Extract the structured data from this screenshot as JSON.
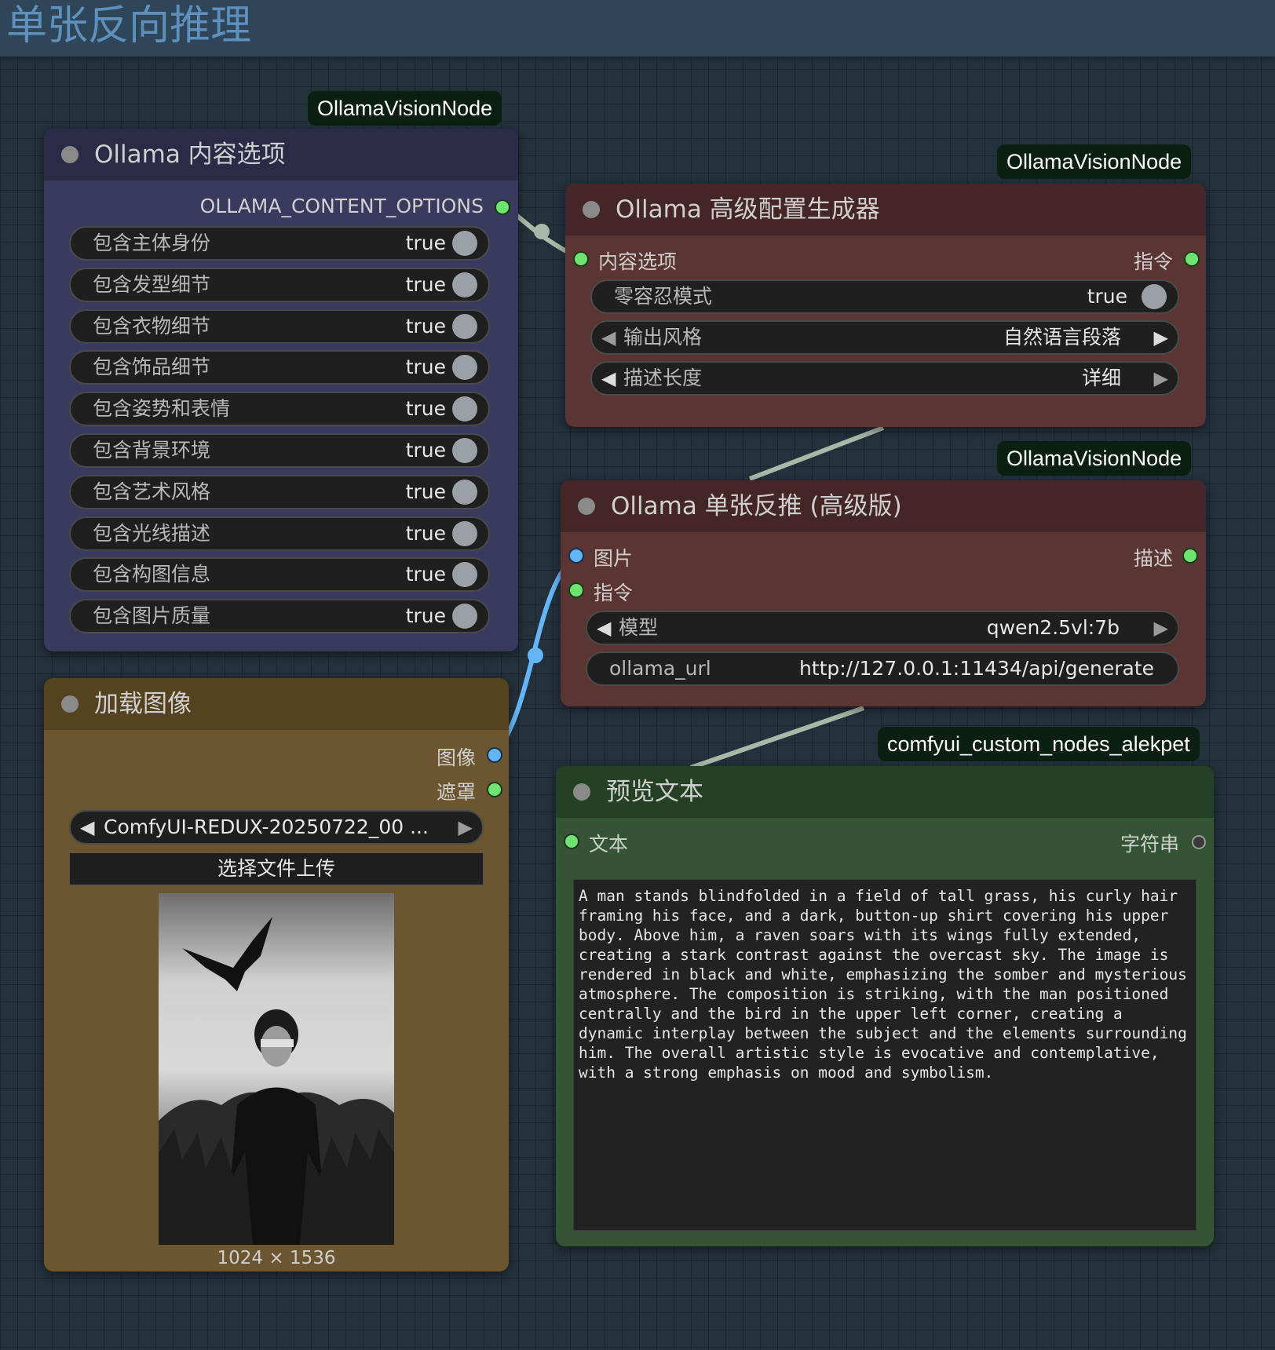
{
  "group": {
    "title": "单张反向推理"
  },
  "tags": {
    "content_options": "OllamaVisionNode",
    "config_generator": "OllamaVisionNode",
    "single_reverse": "OllamaVisionNode",
    "preview_text": "comfyui_custom_nodes_alekpet"
  },
  "content_options_node": {
    "title": "Ollama 内容选项",
    "output_label": "OLLAMA_CONTENT_OPTIONS",
    "toggles": [
      {
        "label": "包含主体身份",
        "value": "true"
      },
      {
        "label": "包含发型细节",
        "value": "true"
      },
      {
        "label": "包含衣物细节",
        "value": "true"
      },
      {
        "label": "包含饰品细节",
        "value": "true"
      },
      {
        "label": "包含姿势和表情",
        "value": "true"
      },
      {
        "label": "包含背景环境",
        "value": "true"
      },
      {
        "label": "包含艺术风格",
        "value": "true"
      },
      {
        "label": "包含光线描述",
        "value": "true"
      },
      {
        "label": "包含构图信息",
        "value": "true"
      },
      {
        "label": "包含图片质量",
        "value": "true"
      }
    ]
  },
  "config_node": {
    "title": "Ollama 高级配置生成器",
    "input_label": "内容选项",
    "output_label": "指令",
    "zero_tolerance": {
      "label": "零容忍模式",
      "value": "true"
    },
    "output_style": {
      "label": "输出风格",
      "value": "自然语言段落"
    },
    "description_length": {
      "label": "描述长度",
      "value": "详细"
    }
  },
  "reverse_node": {
    "title": "Ollama 单张反推 (高级版)",
    "input_image": "图片",
    "input_instruction": "指令",
    "output_label": "描述",
    "model": {
      "label": "模型",
      "value": "qwen2.5vl:7b"
    },
    "url": {
      "label": "ollama_url",
      "value": "http://127.0.0.1:11434/api/generate"
    }
  },
  "load_image_node": {
    "title": "加载图像",
    "output_image": "图像",
    "output_mask": "遮罩",
    "file": "ComfyUI-REDUX-20250722_00  ...",
    "upload_button": "选择文件上传",
    "dimensions": "1024 × 1536"
  },
  "preview_node": {
    "title": "预览文本",
    "input_label": "文本",
    "output_label": "字符串",
    "text": "A man stands blindfolded in a field of tall grass, his curly hair framing his face, and a dark, button-up shirt covering his upper body. Above him, a raven soars with its wings fully extended, creating a stark contrast against the overcast sky. The image is rendered in black and white, emphasizing the somber and mysterious atmosphere. The composition is striking, with the man positioned centrally and the bird in the upper left corner, creating a dynamic interplay between the subject and the elements surrounding him. The overall artistic style is evocative and contemplative, with a strong emphasis on mood and symbolism."
  },
  "colors": {
    "canvas": "#24303a",
    "content_options_body": "#3a3a5e",
    "config_body": "#5b3434",
    "load_image_body": "#6b5630",
    "preview_body": "#335533",
    "slot_green": "#6fe36f",
    "slot_blue": "#64b5f6"
  }
}
